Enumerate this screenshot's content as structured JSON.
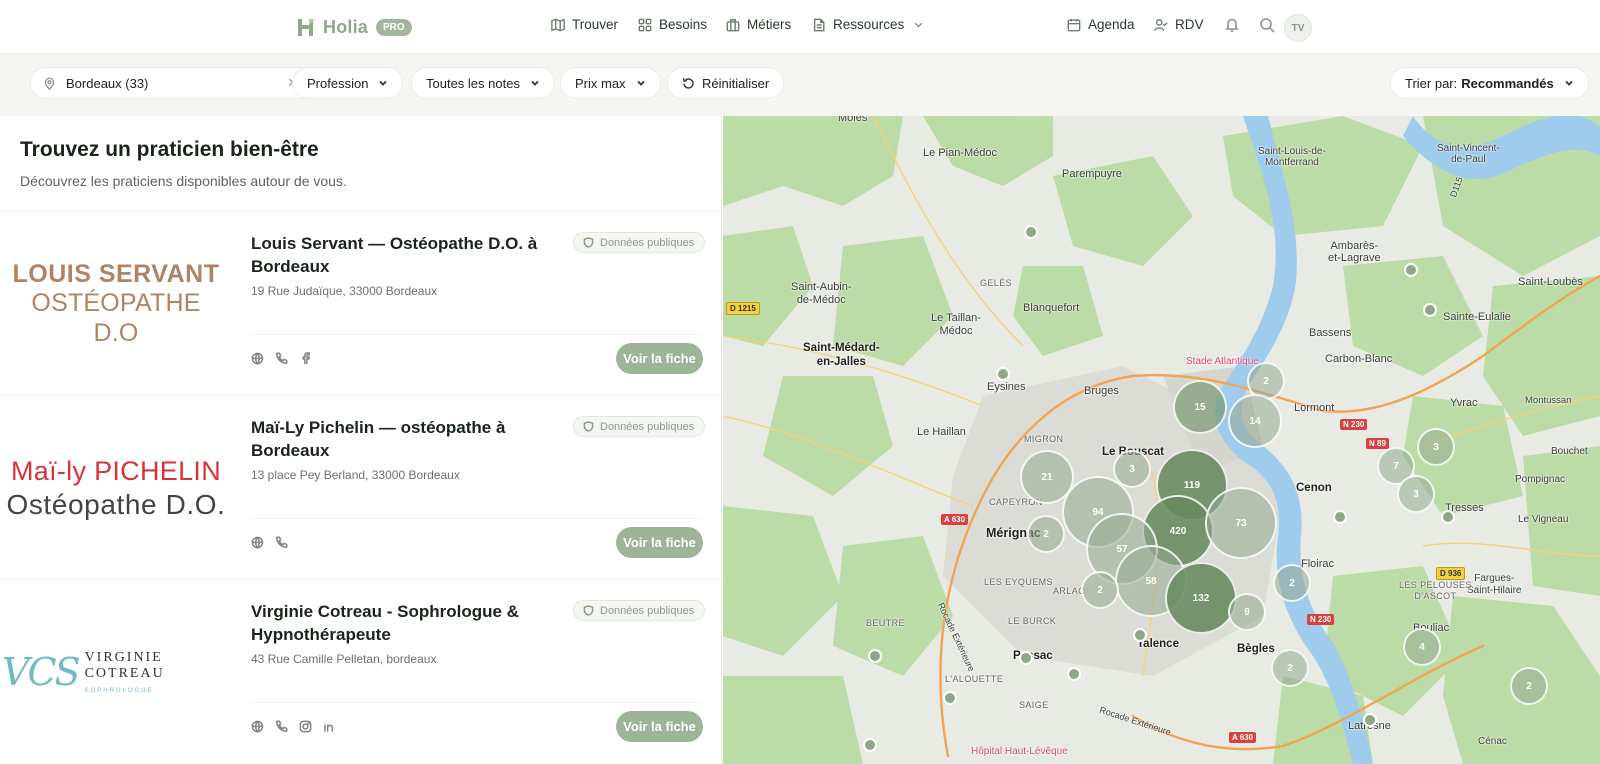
{
  "header": {
    "brand": "Holia",
    "pro_badge": "PRO",
    "nav": [
      {
        "label": "Trouver",
        "icon": "map-icon"
      },
      {
        "label": "Besoins",
        "icon": "grid-icon"
      },
      {
        "label": "Métiers",
        "icon": "briefcase-icon"
      },
      {
        "label": "Ressources",
        "icon": "document-icon"
      }
    ],
    "agenda_label": "Agenda",
    "rdv_label": "RDV",
    "avatar_initials": "TV"
  },
  "filters": {
    "location_value": "Bordeaux (33)",
    "profession_label": "Profession",
    "notes_label": "Toutes les notes",
    "prix_label": "Prix max",
    "reset_label": "Réinitialiser",
    "sort_prefix": "Trier par:",
    "sort_value": "Recommandés"
  },
  "list": {
    "title": "Trouvez un praticien bien-être",
    "subtitle": "Découvrez les praticiens disponibles autour de vous.",
    "public_badge": "Données publiques",
    "cta_label": "Voir la fiche",
    "cards": [
      {
        "title": "Louis Servant — Ostéopathe D.O. à Bordeaux",
        "address": "19 Rue Judaïque, 33000 Bordeaux",
        "logo_line1": "LOUIS SERVANT",
        "logo_line2": "OSTÉOPATHE D.O",
        "icons": [
          "globe-icon",
          "phone-icon",
          "facebook-icon"
        ]
      },
      {
        "title": "Maï-Ly Pichelin — ostéopathe à Bordeaux",
        "address": "13 place Pey Berland, 33000 Bordeaux",
        "logo_line1": "Maï-ly PICHELIN",
        "logo_line2": "Ostéopathe D.O.",
        "icons": [
          "globe-icon",
          "phone-icon"
        ]
      },
      {
        "title": "Virginie Cotreau - Sophrologue & Hypnothérapeute",
        "address": "43 Rue Camille Pelletan, bordeaux",
        "logo_mono": "VCS",
        "logo_line1": "VIRGINIE COTREAU",
        "logo_line2": "SOPHROLOGUE",
        "icons": [
          "globe-icon",
          "phone-icon",
          "instagram-icon",
          "linkedin-icon"
        ]
      }
    ]
  },
  "map": {
    "places": [
      "Moles",
      "Le Pian-Médoc",
      "Parempuyre",
      "Saint-Louis-de-Montferrand",
      "Saint-Vincent-de-Paul",
      "Ambarès-et-Lagrave",
      "Saint-Loubès",
      "Saint-Aubin-de-Médoc",
      "Blanquefort",
      "Le Taillan-Médoc",
      "Saint-Médard-en-Jalles",
      "Sainte-Eulalie",
      "Bassens",
      "Carbon-Blanc",
      "Eysines",
      "Bruges",
      "Lormont",
      "Yvrac",
      "Montussan",
      "Le Haillan",
      "Le Bouscat",
      "Cenon",
      "Bouchet",
      "Tresses",
      "Pompignac",
      "Le Vigneau",
      "Mérignac",
      "Floirac",
      "Pessac",
      "Talence",
      "Bègles",
      "Bouliac",
      "Fargues-Saint-Hilaire",
      "Latresne",
      "Cénac"
    ],
    "districts": [
      "GELÈS",
      "MIGRON",
      "CAPEYRON",
      "LES EYQUEMS",
      "ARLAC",
      "BEUTRE",
      "LE BURCK",
      "L'ALOUETTE",
      "SAIGE",
      "LES PELOUSES D'ASCOT"
    ],
    "pois": [
      "Stade Atlantique",
      "Hôpital Haut-Lévêque"
    ],
    "roads": [
      "D 1215",
      "A 630",
      "N 230",
      "N 89",
      "D 936",
      "D115",
      "Rocade Extérieure"
    ],
    "clusters": [
      "2",
      "15",
      "14",
      "3",
      "21",
      "94",
      "119",
      "420",
      "73",
      "57",
      "2",
      "58",
      "132",
      "2",
      "9",
      "2",
      "2",
      "7",
      "3",
      "3",
      "4",
      "2"
    ]
  }
}
